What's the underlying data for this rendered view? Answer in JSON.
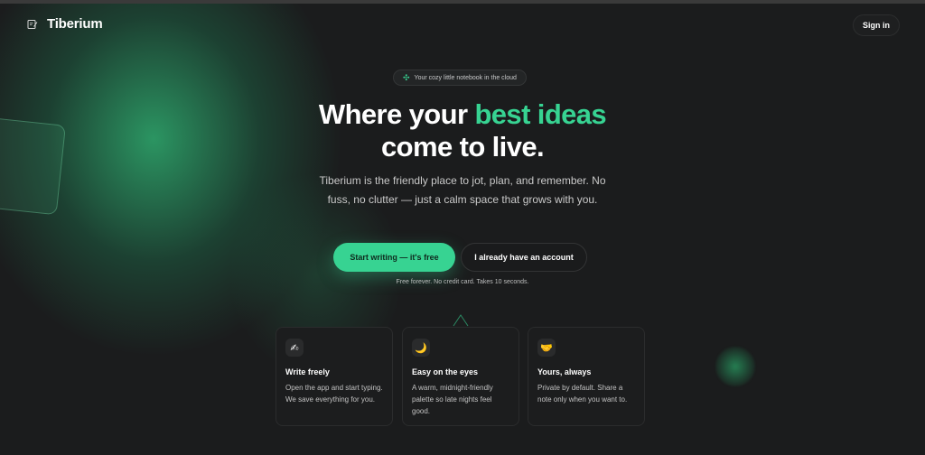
{
  "header": {
    "logo_text": "Tiberium",
    "signin_label": "Sign in"
  },
  "hero": {
    "pill_text": "Your cozy little notebook in the cloud",
    "headline_part1": "Where your ",
    "headline_accent": "best ideas",
    "headline_part2": "come to live.",
    "subtitle": "Tiberium is the friendly place to jot, plan, and remember. No fuss, no clutter — just a calm space that grows with you.",
    "primary_button": "Start writing — it's free",
    "secondary_button": "I already have an account",
    "fineprint": "Free forever. No credit card. Takes 10 seconds."
  },
  "features": [
    {
      "icon": "✍",
      "icon_name": "writing-hand-icon",
      "title": "Write freely",
      "text": "Open the app and start typing. We save everything for you."
    },
    {
      "icon": "🌙",
      "icon_name": "moon-icon",
      "title": "Easy on the eyes",
      "text": "A warm, midnight-friendly palette so late nights feel good."
    },
    {
      "icon": "🤝",
      "icon_name": "handshake-icon",
      "title": "Yours, always",
      "text": "Private by default. Share a note only when you want to."
    }
  ],
  "colors": {
    "accent": "#37d392",
    "background": "#1b1c1d"
  }
}
